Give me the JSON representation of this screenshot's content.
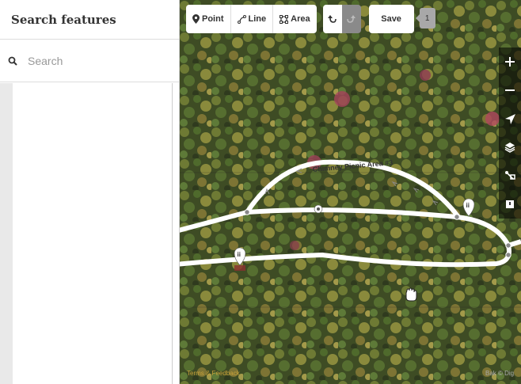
{
  "sidebar": {
    "title": "Search features",
    "search": {
      "placeholder": "Search",
      "value": ""
    }
  },
  "toolbar": {
    "point_label": "Point",
    "line_label": "Line",
    "area_label": "Area",
    "save_label": "Save",
    "edit_count": "1"
  },
  "map": {
    "road_label": "Chimney Picnic Area #3",
    "footer_link": "Terms & Feedback",
    "attribution": "Bak © Dig"
  },
  "colors": {
    "toolbar_bg": "#ffffff",
    "redo_disabled": "#8a8a8a",
    "count_badge": "#a8a8a8",
    "controls_bg": "#000000"
  },
  "icons": [
    "search-icon",
    "point-icon",
    "line-icon",
    "area-icon",
    "undo-icon",
    "redo-icon",
    "zoom-in-icon",
    "zoom-out-icon",
    "geolocate-icon",
    "layers-icon",
    "map-data-icon",
    "issues-icon",
    "toilets-icon",
    "hand-cursor-icon"
  ]
}
